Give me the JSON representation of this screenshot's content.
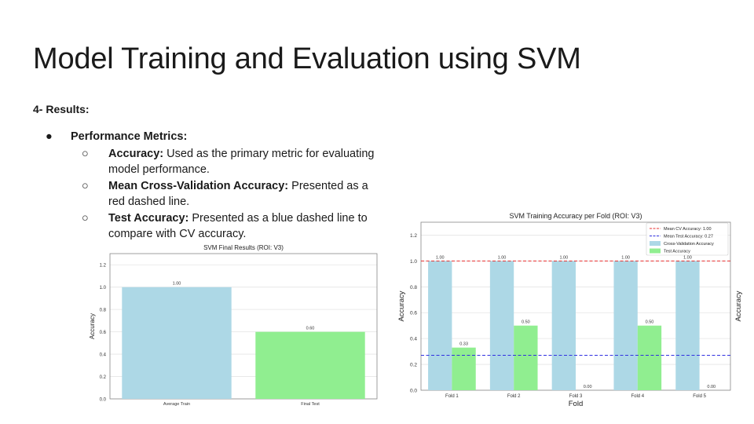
{
  "slide": {
    "title": "Model Training and Evaluation using SVM",
    "section": "4- Results:",
    "bullet": {
      "marker": "●",
      "label": "Performance Metrics:"
    },
    "subitems": [
      {
        "marker": "○",
        "bold": "Accuracy:",
        "text": " Used as the primary metric for evaluating model performance."
      },
      {
        "marker": "○",
        "bold": "Mean Cross-Validation Accuracy:",
        "text": " Presented as a red dashed line."
      },
      {
        "marker": "○",
        "bold": "Test Accuracy:",
        "text": " Presented as a blue dashed line to compare with CV accuracy."
      }
    ]
  },
  "chart_data": [
    {
      "type": "bar",
      "title": "SVM Final Results (ROI: V3)",
      "ylabel": "Accuracy",
      "xlabel": "",
      "ylim": [
        0,
        1.3
      ],
      "yticks": [
        0.0,
        0.2,
        0.4,
        0.6,
        0.8,
        1.0,
        1.2
      ],
      "categories": [
        "Average Train",
        "Final Test"
      ],
      "values": [
        1.0,
        0.6
      ],
      "value_labels": [
        "1.00",
        "0.60"
      ],
      "colors": [
        "#add8e6",
        "#90ee90"
      ],
      "grid": true
    },
    {
      "type": "bar",
      "title": "SVM Training Accuracy per Fold (ROI: V3)",
      "ylabel": "Accuracy",
      "right_ylabel": "Accuracy",
      "xlabel": "Fold",
      "ylim": [
        0,
        1.3
      ],
      "yticks": [
        0.0,
        0.2,
        0.4,
        0.6,
        0.8,
        1.0,
        1.2
      ],
      "categories": [
        "Fold 1",
        "Fold 2",
        "Fold 3",
        "Fold 4",
        "Fold 5"
      ],
      "series": [
        {
          "name": "Cross-Validation Accuracy",
          "color": "#add8e6",
          "values": [
            1.0,
            1.0,
            1.0,
            1.0,
            1.0
          ],
          "labels": [
            "1.00",
            "1.00",
            "1.00",
            "1.00",
            "1.00"
          ]
        },
        {
          "name": "Test Accuracy",
          "color": "#90ee90",
          "values": [
            0.33,
            0.5,
            0.0,
            0.5,
            0.0
          ],
          "labels": [
            "0.33",
            "0.50",
            "0.00",
            "0.50",
            "0.00"
          ]
        }
      ],
      "reference_lines": [
        {
          "name": "Mean CV Accuracy: 1.00",
          "value": 1.0,
          "color": "#e83030"
        },
        {
          "name": "Mean Test Accuracy: 0.27",
          "value": 0.27,
          "color": "#3030e0"
        }
      ],
      "legend": "top-right",
      "grid": true
    }
  ]
}
